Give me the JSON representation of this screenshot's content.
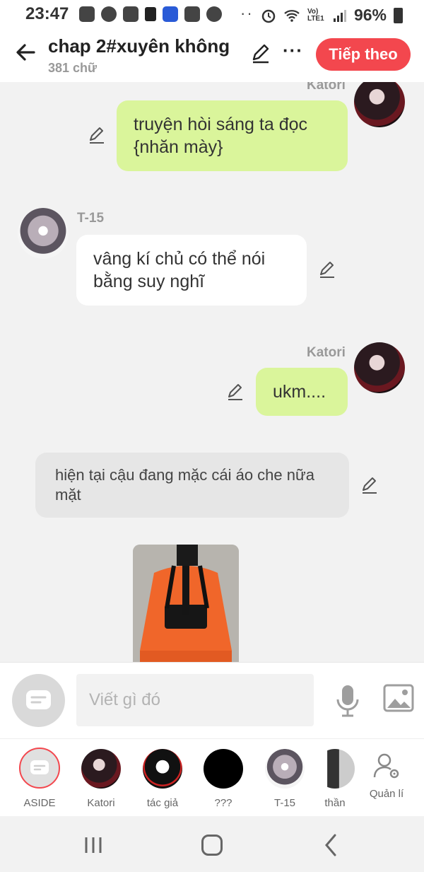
{
  "status_bar": {
    "time": "23:47",
    "battery_text": "96%",
    "icons": [
      "bag-icon",
      "messenger-icon",
      "vn-icon",
      "tiktok-icon",
      "shield-app-icon",
      "check-icon",
      "m-app-icon",
      "alarm-icon",
      "wifi-icon",
      "signal-icon",
      "battery-icon"
    ],
    "network_label": "Vo) LTE1"
  },
  "header": {
    "title": "chap 2#xuyên không",
    "word_count": "381 chữ",
    "next_label": "Tiếp theo",
    "more_label": "···",
    "accent_color": "#f3474e"
  },
  "messages": [
    {
      "sender": "Katori",
      "side": "right",
      "style": "green",
      "text_lines": [
        "truyện hòi sáng ta đọc",
        "{nhăn mày}"
      ]
    },
    {
      "sender": "T-15",
      "side": "left",
      "style": "white",
      "text_lines": [
        "vâng kí chủ có thể nói",
        "bằng suy nghĩ"
      ]
    },
    {
      "sender": "Katori",
      "side": "right",
      "style": "green",
      "text_lines": [
        "ukm...."
      ]
    },
    {
      "sender": "",
      "side": "center",
      "style": "aside",
      "text_lines": [
        "hiện tại cậu đang mặc cái áo che nữa",
        "mặt"
      ]
    }
  ],
  "composer": {
    "placeholder": "Viết gì đó"
  },
  "characters": [
    {
      "label": "ASIDE",
      "selected": true
    },
    {
      "label": "Katori"
    },
    {
      "label": "tác giả"
    },
    {
      "label": "???"
    },
    {
      "label": "T-15"
    },
    {
      "label": "thần"
    },
    {
      "label": "Quản lí"
    }
  ],
  "colors": {
    "green_bubble": "#daf59b",
    "aside_bubble": "#e6e6e6",
    "background": "#f2f2f2"
  }
}
